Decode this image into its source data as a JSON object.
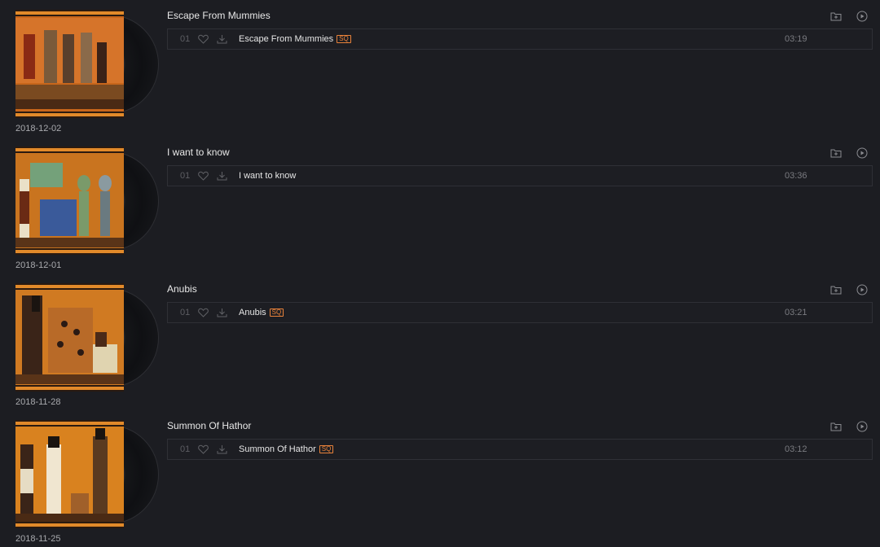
{
  "albums": [
    {
      "title": "Escape From Mummies",
      "date": "2018-12-02",
      "track": {
        "number": "01",
        "title": "Escape From Mummies",
        "badge": "SQ",
        "duration": "03:19"
      }
    },
    {
      "title": "I want to know",
      "date": "2018-12-01",
      "track": {
        "number": "01",
        "title": "I want to know",
        "badge": "",
        "duration": "03:36"
      }
    },
    {
      "title": "Anubis",
      "date": "2018-11-28",
      "track": {
        "number": "01",
        "title": "Anubis",
        "badge": "SQ",
        "duration": "03:21"
      }
    },
    {
      "title": "Summon Of Hathor",
      "date": "2018-11-25",
      "track": {
        "number": "01",
        "title": "Summon Of Hathor",
        "badge": "SQ",
        "duration": "03:12"
      }
    }
  ],
  "icons": {
    "add_to_folder": "folder-add-icon",
    "play_all": "play-circle-icon",
    "like": "heart-icon",
    "download": "download-icon"
  },
  "colors": {
    "background": "#1c1d22",
    "accent_badge": "#e9823a"
  }
}
